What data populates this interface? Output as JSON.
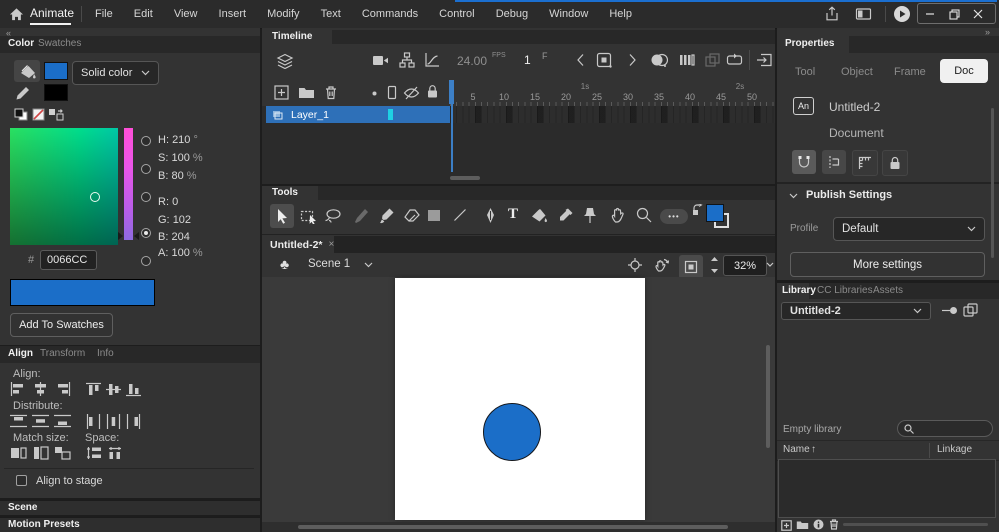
{
  "titlebar": {
    "app": "Animate",
    "menus": [
      "File",
      "Edit",
      "View",
      "Insert",
      "Modify",
      "Text",
      "Commands",
      "Control",
      "Debug",
      "Window",
      "Help"
    ]
  },
  "color_panel": {
    "tabs": [
      "Color",
      "Swatches"
    ],
    "active_tab": "Color",
    "type_dropdown": "Solid color",
    "rows": [
      {
        "label": "H:",
        "value": "210",
        "unit": "°"
      },
      {
        "label": "S:",
        "value": "100",
        "unit": "%"
      },
      {
        "label": "B:",
        "value": "80",
        "unit": "%"
      },
      {
        "label": "R:",
        "value": "0",
        "unit": ""
      },
      {
        "label": "G:",
        "value": "102",
        "unit": ""
      },
      {
        "label": "B:",
        "value": "204",
        "unit": ""
      },
      {
        "label": "A:",
        "value": "100",
        "unit": "%"
      }
    ],
    "hex_symbol": "#",
    "hex_value": "0066CC",
    "add_button": "Add To Swatches"
  },
  "align_panel": {
    "tabs": [
      "Align",
      "Transform",
      "Info"
    ],
    "active_tab": "Align",
    "labels": {
      "align": "Align:",
      "distribute": "Distribute:",
      "match_size": "Match size:",
      "space": "Space:"
    },
    "checkbox_label": "Align to stage"
  },
  "bottom_panels": {
    "scene": "Scene",
    "motion_presets": "Motion Presets"
  },
  "timeline": {
    "title": "Timeline",
    "fps": "24.00",
    "fps_unit": "FPS",
    "current_frame": "1",
    "frame_type": "F",
    "ruler": {
      "numbers": [
        "5",
        "10",
        "15",
        "20",
        "25",
        "30",
        "35",
        "40",
        "45",
        "50"
      ],
      "seconds": [
        "1s",
        "2s"
      ]
    },
    "layer": {
      "name": "Layer_1"
    }
  },
  "tools": {
    "title": "Tools"
  },
  "document": {
    "tab_title": "Untitled-2*",
    "scene": "Scene 1",
    "zoom": "32%"
  },
  "properties": {
    "title": "Properties",
    "tabs": [
      "Tool",
      "Object",
      "Frame",
      "Doc"
    ],
    "active_tab": "Doc",
    "doc_badge": "An",
    "doc_name": "Untitled-2",
    "doc_kind": "Document",
    "publish_section": "Publish Settings",
    "profile_label": "Profile",
    "profile_value": "Default",
    "more_button": "More settings"
  },
  "library": {
    "tabs": [
      "Library",
      "CC Libraries",
      "Assets"
    ],
    "active_tab": "Library",
    "selected_doc": "Untitled-2",
    "empty_text": "Empty library",
    "columns": {
      "name": "Name",
      "linkage": "Linkage"
    }
  },
  "icons": {
    "collapse_left": "«",
    "expand_right": "»",
    "sort_asc": "↑",
    "symbol_clubs": "♣",
    "more_dots": "•••",
    "text_tool": "T",
    "tab_close": "×"
  },
  "colors": {
    "fill_blue": "#1b6ec8",
    "fill_hex": "#0066CC",
    "keyframe_cyan": "#1fd1e3",
    "layer_selected_blue": "#2e70b8",
    "doc_tab_active": "#f0f0f0"
  }
}
